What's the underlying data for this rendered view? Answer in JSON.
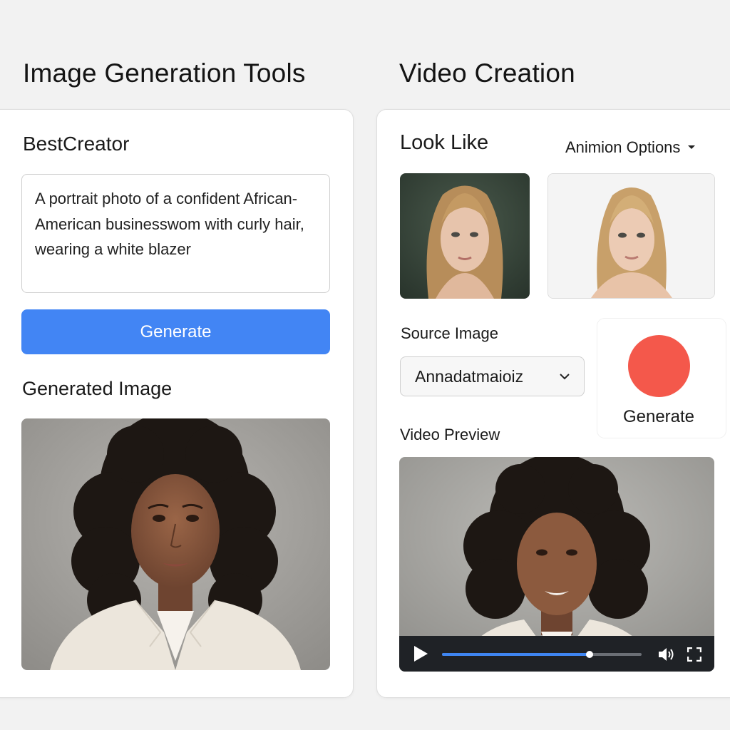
{
  "titles": {
    "left": "Image Generation Tools",
    "right": "Video Creation"
  },
  "image_tool": {
    "app_name": "BestCreator",
    "prompt_text": "A portrait photo of a confident African-American businesswom with curly hair, wearing a white blazer",
    "generate_label": "Generate",
    "generated_label": "Generated Image"
  },
  "video_tool": {
    "look_like_label": "Look Like",
    "options_label": "Animion Options",
    "source_label": "Source Image",
    "source_value": "Annadatmaioiz",
    "record_label": "Generate",
    "preview_label": "Video Preview",
    "progress": 0.74
  },
  "colors": {
    "accent": "#4285f4",
    "record": "#f4584b",
    "player_bar": "#1f2226"
  },
  "icons": {
    "options_toggle": "caret-down-icon",
    "select_toggle": "chevron-down-icon",
    "play": "play-icon",
    "volume": "volume-icon",
    "fullscreen": "fullscreen-icon"
  }
}
